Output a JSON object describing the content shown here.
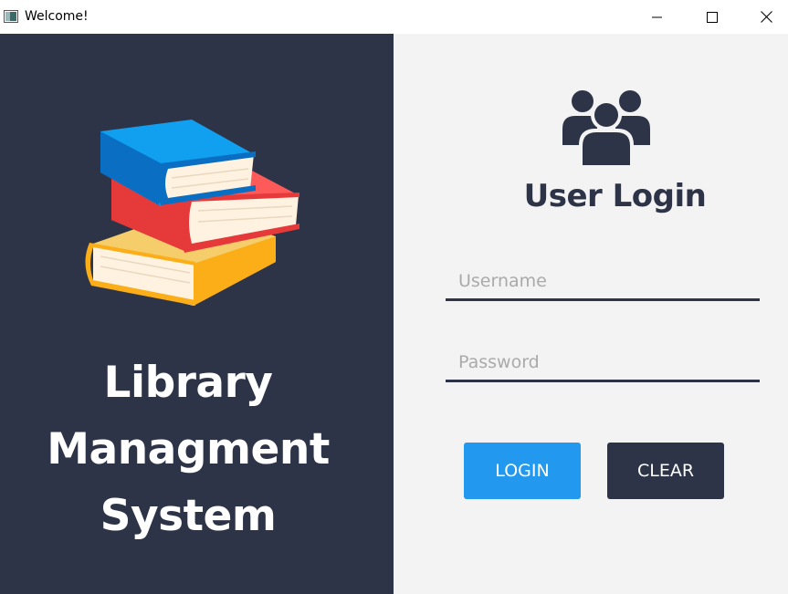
{
  "window": {
    "title": "Welcome!",
    "app_icon": "window-app-icon",
    "controls": [
      "minimize-icon",
      "maximize-icon",
      "close-icon"
    ]
  },
  "left_panel": {
    "illustration": "stacked-books-icon",
    "title_lines": [
      "Library",
      "Managment",
      "System"
    ],
    "background_color": "#2e3447"
  },
  "right_panel": {
    "icon": "users-group-icon",
    "heading": "User Login",
    "username": {
      "placeholder": "Username",
      "value": ""
    },
    "password": {
      "placeholder": "Password",
      "value": ""
    },
    "buttons": {
      "login_label": "LOGIN",
      "clear_label": "CLEAR"
    },
    "background_color": "#f3f3f3",
    "accent_color": "#2299ee"
  }
}
